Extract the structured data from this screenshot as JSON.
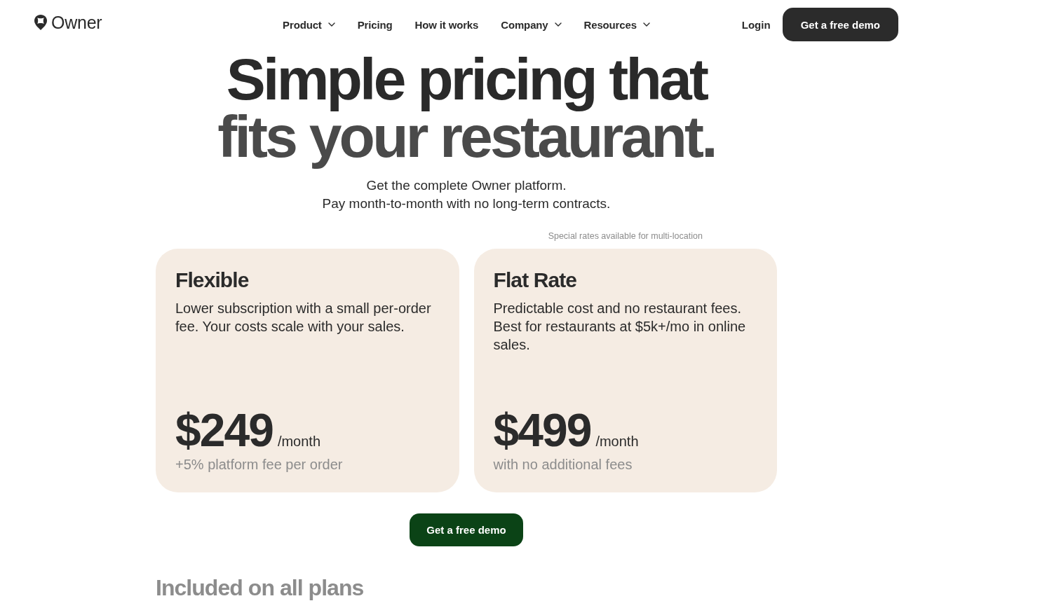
{
  "header": {
    "logo": "Owner",
    "nav": [
      {
        "label": "Product",
        "dropdown": true
      },
      {
        "label": "Pricing",
        "dropdown": false
      },
      {
        "label": "How it works",
        "dropdown": false
      },
      {
        "label": "Company",
        "dropdown": true
      },
      {
        "label": "Resources",
        "dropdown": true
      }
    ],
    "login": "Login",
    "cta": "Get a free demo"
  },
  "hero": {
    "title_lines": [
      "Simple pricing that",
      "fits your restaurant."
    ],
    "subtitle_lines": [
      "Get the complete Owner platform.",
      "Pay month-to-month with no long-term contracts."
    ]
  },
  "plans_note": "Special rates available for multi-location",
  "plans": [
    {
      "name": "Flexible",
      "description": "Lower subscription with a small per-order fee. Your costs scale with your sales.",
      "price": "$249",
      "period": "/month",
      "fee_note": "+5% platform fee per order"
    },
    {
      "name": "Flat Rate",
      "description": "Predictable cost and no restaurant fees. Best for restaurants at $5k+/mo in online sales.",
      "price": "$499",
      "period": "/month",
      "fee_note": "with no additional fees"
    }
  ],
  "cta": "Get a free demo",
  "next_section_title": "Included on all plans"
}
